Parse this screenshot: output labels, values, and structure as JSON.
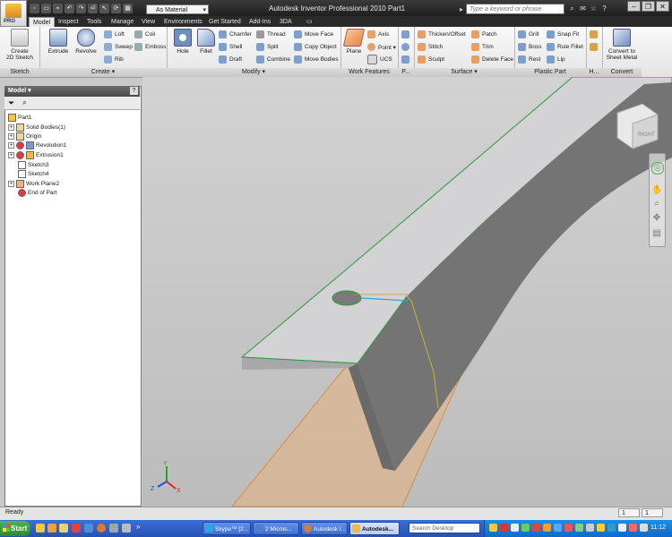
{
  "window": {
    "title": "Autodesk Inventor Professional 2010    Part1",
    "app_badge": "PRO",
    "material": "As Material",
    "search_placeholder": "Type a keyword or phrase"
  },
  "tabs": [
    "Model",
    "Inspect",
    "Tools",
    "Manage",
    "View",
    "Environments",
    "Get Started",
    "Add-Ins",
    "3DA"
  ],
  "ribbon": {
    "sketch": {
      "title": "Sketch",
      "create_line1": "Create",
      "create_line2": "2D Sketch"
    },
    "create": {
      "title": "Create",
      "extrude": "Extrude",
      "revolve": "Revolve",
      "loft": "Loft",
      "sweep": "Sweep",
      "rib": "Rib",
      "coil": "Coil",
      "emboss": "Emboss"
    },
    "modify": {
      "title": "Modify",
      "hole": "Hole",
      "fillet": "Fillet",
      "chamfer": "Chamfer",
      "shell": "Shell",
      "draft": "Draft",
      "thread": "Thread",
      "split": "Split",
      "combine": "Combine",
      "move_face": "Move Face",
      "copy_object": "Copy Object",
      "move_bodies": "Move Bodies"
    },
    "work_features": {
      "title": "Work Features",
      "plane": "Plane",
      "axis": "Axis",
      "point": "Point",
      "ucs": "UCS"
    },
    "pattern": {
      "title": "P..."
    },
    "surface": {
      "title": "Surface",
      "thicken": "Thicken/Offset",
      "stitch": "Stitch",
      "sculpt": "Sculpt",
      "patch": "Patch",
      "trim": "Trim",
      "delete_face": "Delete Face"
    },
    "plastic": {
      "title": "Plastic Part",
      "grill": "Grill",
      "boss": "Boss",
      "rest": "Rest",
      "snap_fit": "Snap Fit",
      "rule_fillet": "Rule Fillet",
      "lip": "Lip"
    },
    "harness": {
      "title": "H..."
    },
    "convert": {
      "title": "Convert",
      "line1": "Convert to",
      "line2": "Sheet Metal"
    }
  },
  "browser": {
    "title": "Model",
    "help": "?",
    "items": [
      "Part1",
      "Solid Bodies(1)",
      "Origin",
      "Revolution1",
      "Extrusion1",
      "Sketch3",
      "Sketch4",
      "Work Plane2",
      "End of Part"
    ]
  },
  "viewcube": {
    "face": "RIGHT"
  },
  "triad": {
    "x": "X",
    "y": "Y",
    "z": "Z"
  },
  "status": {
    "text": "Ready",
    "cell1": "1",
    "cell2": "1"
  },
  "taskbar": {
    "start": "Start",
    "tasks": [
      "Skype™ [2...",
      "2 Micros...",
      "Autodesk I...",
      "Autodesk..."
    ],
    "search_placeholder": "Search Desktop",
    "clock": "11:12"
  },
  "colors": {
    "titlebar": "#1c1c1c",
    "part_top": "#d4d4d6",
    "part_side": "#747474",
    "plane": "#e3a56c",
    "edge": "#2f9a3a",
    "taskbar": "#2452b8"
  }
}
